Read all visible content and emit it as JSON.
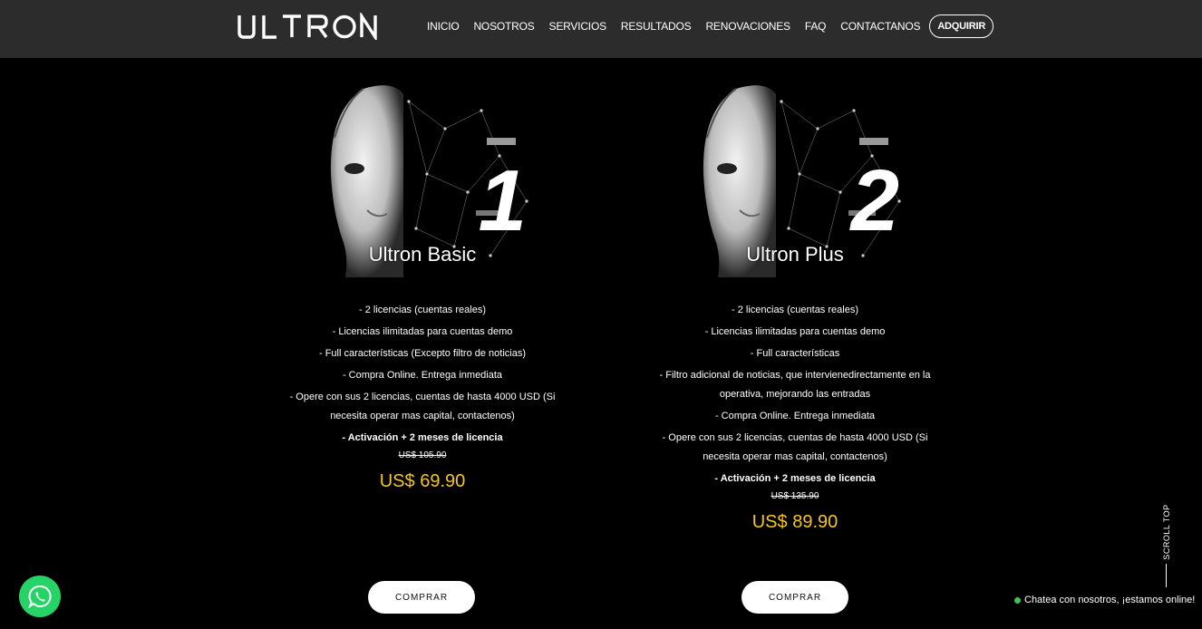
{
  "header": {
    "logo_text": "ULTRON",
    "nav": [
      "INICIO",
      "NOSOTROS",
      "SERVICIOS",
      "RESULTADOS",
      "RENOVACIONES",
      "FAQ",
      "CONTACTANOS"
    ],
    "cta": "ADQUIRIR"
  },
  "plans": [
    {
      "number": "1",
      "title": "Ultron Basic",
      "features": [
        "- 2 licencias (cuentas reales)",
        "- Licencias ilimitadas para cuentas demo",
        "- Full características (Excepto filtro de noticias)",
        "- Compra Online. Entrega inmediata",
        "- Opere con sus 2 licencias, cuentas de hasta 4000 USD (Si necesita operar mas capital, contactenos)",
        "- Activación + 2 meses de licencia"
      ],
      "old_price": "US$ 105.90",
      "price": "US$ 69.90",
      "button": "COMPRAR"
    },
    {
      "number": "2",
      "title": "Ultron Plus",
      "features": [
        "- 2 licencias (cuentas reales)",
        "- Licencias ilimitadas para cuentas demo",
        "- Full características",
        "- Filtro adicional de noticias, que intervienedirectamente en la operativa, mejorando las entradas",
        "- Compra Online. Entrega inmediata",
        "- Opere con sus 2 licencias, cuentas de hasta 4000 USD (Si necesita operar mas capital, contactenos)",
        "- Activación + 2 meses de licencia"
      ],
      "old_price": "US$ 135.90",
      "price": "US$ 89.90",
      "button": "COMPRAR"
    }
  ],
  "scroll_top": "SCROLL TOP",
  "chat_text": "Chatea con nosotros, ¡estamos online!",
  "colors": {
    "price": "#f6c522",
    "header_bg": "#2c2c2c",
    "whatsapp": "#25d366"
  },
  "icons": [
    "whatsapp-icon",
    "online-dot-icon"
  ]
}
